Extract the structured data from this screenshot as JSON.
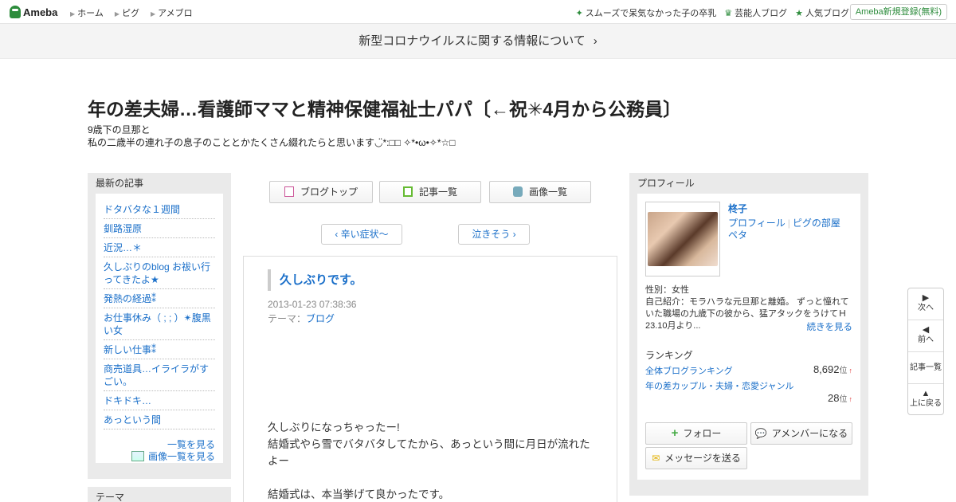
{
  "header": {
    "logo": "Ameba",
    "nav": [
      "ホーム",
      "ピグ",
      "アメブロ"
    ],
    "links": [
      {
        "icon": "sparkle-icon",
        "label": "スムーズで呆気なかった子の卒乳"
      },
      {
        "icon": "crown-icon",
        "label": "芸能人ブログ"
      },
      {
        "icon": "star-icon",
        "label": "人気ブログ"
      }
    ],
    "register_label": "Ameba新規登録(無料)"
  },
  "banner": {
    "text": "新型コロナウイルスに関する情報について",
    "chevron": "›"
  },
  "blog": {
    "title": "年の差夫婦…看護師ママと精神保健福祉士パパ〔←祝✳︎4月から公務員〕",
    "desc_line1": "9歳下の旦那と",
    "desc_line2": "私の二歳半の連れ子の息子のこととかたくさん綴れたらと思います◡̈*:□□ ✧*•ω•✧*☆□"
  },
  "latest": {
    "heading": "最新の記事",
    "items": [
      "ドタバタな１週間",
      "釧路湿原",
      "近況…＊",
      "久しぶりのblog お祓い行ってきたよ★",
      "発熱の経過⁑",
      "お仕事休み（ ; ; ）✴︎腹黒い女",
      "新しい仕事⁑",
      "商売道具…イライラがすごい。",
      "ドキドキ…",
      "あっという間"
    ],
    "more": "一覧を見る",
    "more_images": "画像一覧を見る"
  },
  "theme_heading": "テーマ",
  "tabs": {
    "blog_top": "ブログトップ",
    "entries": "記事一覧",
    "images": "画像一覧"
  },
  "pager": {
    "prev": "‹ 辛い症状～",
    "next": "泣きそう ›"
  },
  "article": {
    "title": "久しぶりです。",
    "date": "2013-01-23 07:38:36",
    "theme_label": "テーマ：",
    "theme": "ブログ",
    "body": [
      "久しぶりになっちゃったー!",
      "結婚式やら雪でバタバタしてたから、あっという間に月日が流れたよー",
      "",
      "結婚式は、本当挙げて良かったです。"
    ]
  },
  "profile": {
    "heading": "プロフィール",
    "name": "柊子",
    "link_profile": "プロフィール",
    "link_pig": "ピグの部屋",
    "link_peta": "ペタ",
    "gender": "性別：女性",
    "intro": "自己紹介：モラハラな元旦那と離婚。 ずっと憧れていた職場の九歳下の彼から、猛アタックをうけてＨ23.10月より...",
    "read_more": "続きを見る",
    "ranking_heading": "ランキング",
    "rank_all_label": "全体ブログランキング",
    "rank_all_value": "8,692",
    "rank_genre_label": "年の差カップル・夫婦・恋愛ジャンル",
    "rank_genre_value": "28",
    "rank_unit": "位",
    "rank_arrow": "↑",
    "follow": "フォロー",
    "amember": "アメンバーになる",
    "message": "メッセージを送る"
  },
  "floatnav": {
    "next": "次へ",
    "prev": "前へ",
    "list": "記事一覧",
    "top": "上に戻る"
  },
  "colors": {
    "accent_link": "#1a6fc9",
    "brand_green": "#2d8c3c",
    "sidebar_bg": "#eaeaea"
  }
}
